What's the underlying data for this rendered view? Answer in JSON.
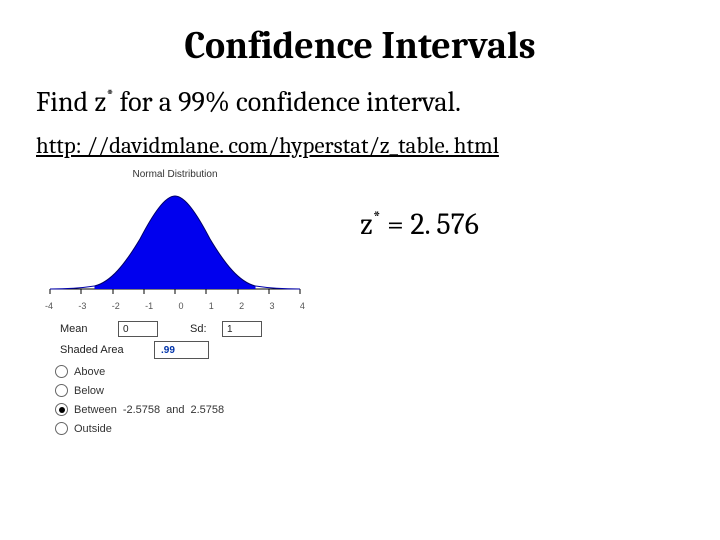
{
  "title": "Confidence Intervals",
  "prompt_pre": "Find z",
  "prompt_sup": "*",
  "prompt_post": " for a 99% confidence interval.",
  "link_text": "http: //davidmlane. com/hyperstat/z_table. html",
  "applet": {
    "title": "Normal Distribution",
    "mean_label": "Mean",
    "mean_value": "0",
    "sd_label": "Sd:",
    "sd_value": "1",
    "shaded_label": "Shaded Area",
    "shaded_value": ".99",
    "options": {
      "above": "Above",
      "below": "Below",
      "between_pre": "Between ",
      "between_lo": "-2.5758",
      "between_mid": " and ",
      "between_hi": "2.5758",
      "outside": "Outside"
    },
    "selected": "between"
  },
  "axis": {
    "t0": "-4",
    "t1": "-3",
    "t2": "-2",
    "t3": "-1",
    "t4": "0",
    "t5": "1",
    "t6": "2",
    "t7": "3",
    "t8": "4"
  },
  "answer_pre": "z",
  "answer_sup": "*",
  "answer_post": " = 2. 576",
  "chart_data": {
    "type": "area",
    "title": "Normal Distribution",
    "xlabel": "",
    "ylabel": "",
    "xlim": [
      -4,
      4
    ],
    "x": [
      -4,
      -3,
      -2,
      -1,
      0,
      1,
      2,
      3,
      4
    ],
    "pdf": [
      0.0001,
      0.0044,
      0.054,
      0.242,
      0.3989,
      0.242,
      0.054,
      0.0044,
      0.0001
    ],
    "shaded_region": [
      -2.5758,
      2.5758
    ],
    "shaded_area": 0.99
  }
}
